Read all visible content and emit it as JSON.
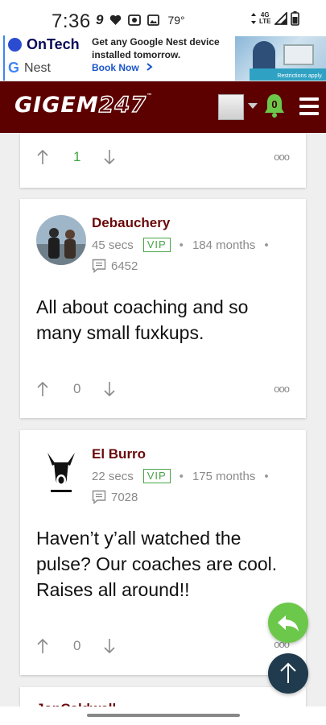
{
  "status_bar": {
    "time": "7:36",
    "notification_icons": [
      "nine-icon",
      "heart-icon",
      "camera-icon",
      "image-icon"
    ],
    "temperature": "79°",
    "network": "4G LTE",
    "right_icons": [
      "data-arrows-icon",
      "signal-icon",
      "battery-icon"
    ]
  },
  "ad": {
    "brand": "OnTech",
    "partner": "Nest",
    "partner_mark": "G",
    "headline": "Get any Google Nest device installed tomorrow.",
    "cta": "Book Now",
    "cta_icon": "chevron-right-icon",
    "disclaimer": "Restrictions apply."
  },
  "header": {
    "logo_part1": "GIGEM",
    "logo_part2": "247",
    "logo_tm": "™",
    "notification_count": "0",
    "icons": [
      "avatar-icon",
      "caret-down-icon",
      "bell-icon",
      "hamburger-menu-icon"
    ],
    "brand_color": "#5c0000"
  },
  "posts": [
    {
      "vote_count": "1",
      "vote_color": "#3caa3c",
      "more_label": "ooo"
    },
    {
      "username": "Debauchery",
      "time_ago": "45 secs",
      "badge": "VIP",
      "membership": "184 months",
      "separator": "•",
      "post_count": "6452",
      "body": "All about coaching and so many small fuxkups.",
      "vote_count": "0",
      "more_label": "ooo"
    },
    {
      "username": "El Burro",
      "time_ago": "22 secs",
      "badge": "VIP",
      "membership": "175 months",
      "separator": "•",
      "post_count": "7028",
      "body": "Haven’t y’all watched the pulse? Our coaches are cool. Raises all around!!",
      "vote_count": "0",
      "more_label": "ooo"
    },
    {
      "username": "JonCaldwell"
    }
  ],
  "floating": {
    "reply_icon": "reply-arrow-icon",
    "top_icon": "arrow-up-icon",
    "reply_color": "#6cc84b",
    "top_color": "#1f3b4d"
  }
}
